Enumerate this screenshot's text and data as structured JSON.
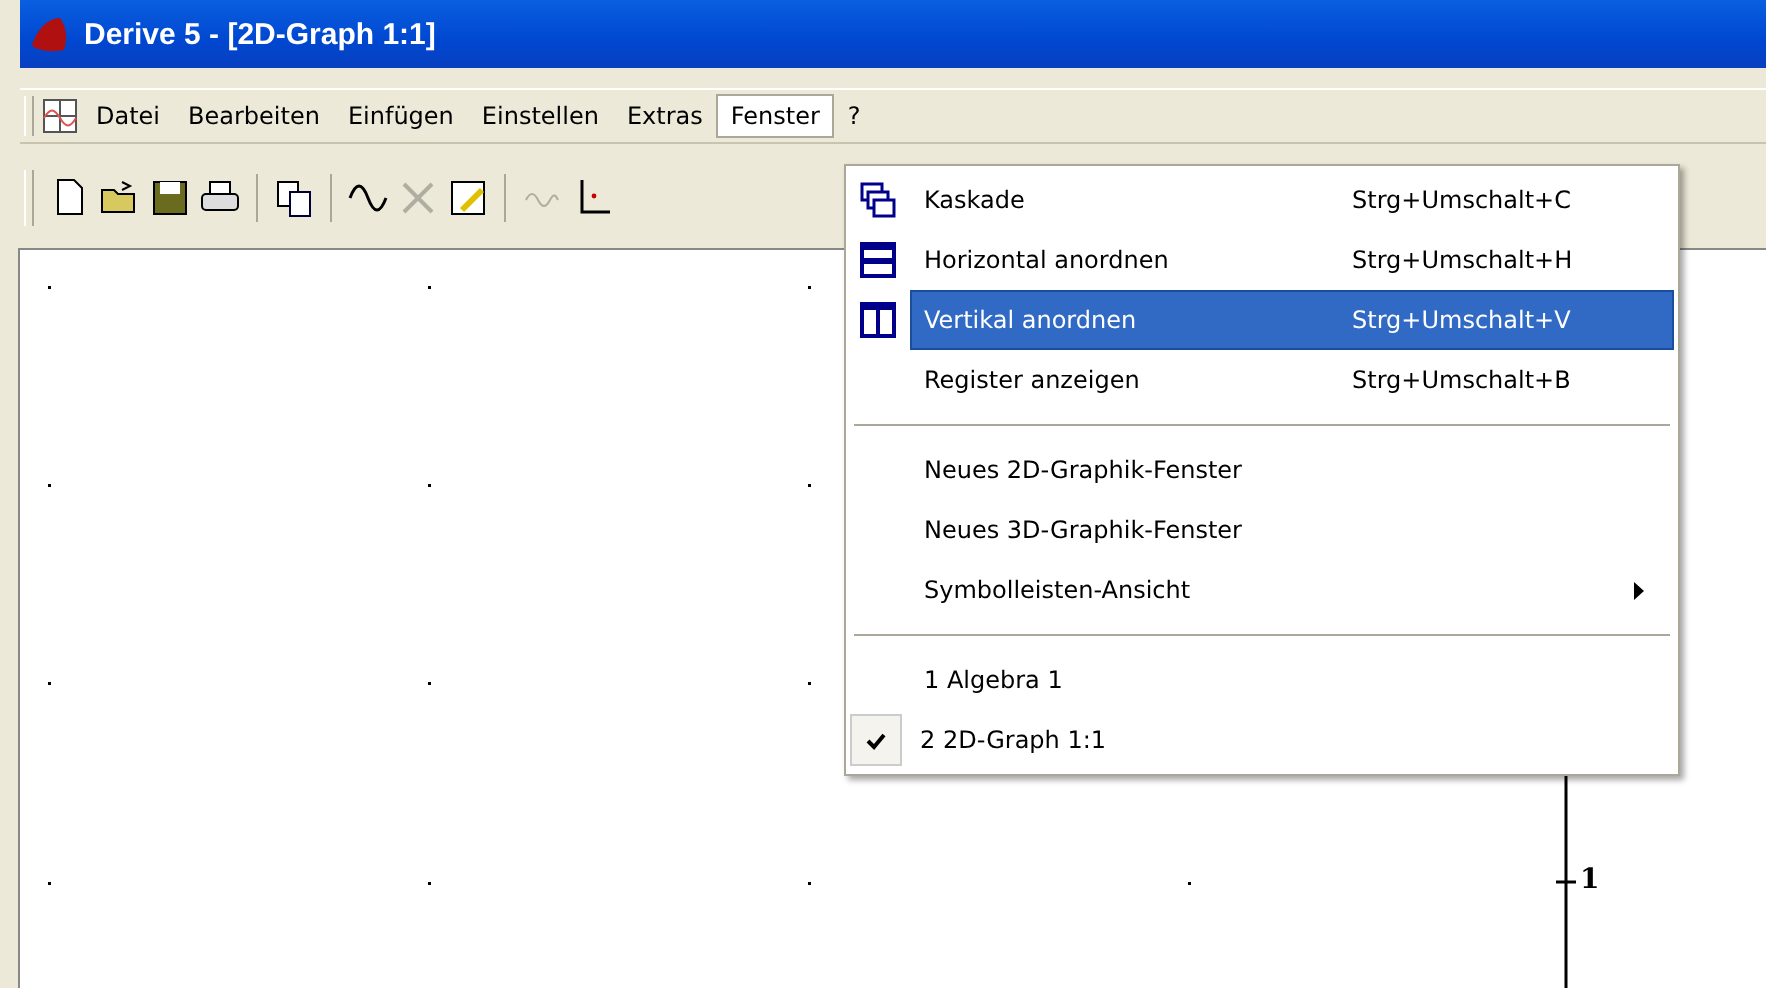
{
  "window": {
    "title": "Derive 5 - [2D-Graph 1:1]"
  },
  "menu_bar": [
    {
      "label": "Datei",
      "open": false
    },
    {
      "label": "Bearbeiten",
      "open": false
    },
    {
      "label": "Einfügen",
      "open": false
    },
    {
      "label": "Einstellen",
      "open": false
    },
    {
      "label": "Extras",
      "open": false
    },
    {
      "label": "Fenster",
      "open": true
    },
    {
      "label": "?",
      "open": false
    }
  ],
  "toolbar": [
    {
      "kind": "new",
      "disabled": false
    },
    {
      "kind": "open",
      "disabled": false
    },
    {
      "kind": "save",
      "disabled": false
    },
    {
      "kind": "print",
      "disabled": false
    },
    {
      "kind": "sep"
    },
    {
      "kind": "copy",
      "disabled": false
    },
    {
      "kind": "sep"
    },
    {
      "kind": "plot",
      "disabled": false
    },
    {
      "kind": "delete",
      "disabled": true
    },
    {
      "kind": "annotate",
      "disabled": false
    },
    {
      "kind": "sep"
    },
    {
      "kind": "trace",
      "disabled": true
    },
    {
      "kind": "axes",
      "disabled": false
    }
  ],
  "dropdown": [
    {
      "kind": "cascade",
      "label": "Kaskade",
      "shortcut": "Strg+Umschalt+C",
      "selected": false,
      "checked": false
    },
    {
      "kind": "tile_horizontal",
      "label": "Horizontal anordnen",
      "shortcut": "Strg+Umschalt+H",
      "selected": false,
      "checked": false
    },
    {
      "kind": "tile_vertical",
      "label": "Vertikal anordnen",
      "shortcut": "Strg+Umschalt+V",
      "selected": true,
      "checked": false
    },
    {
      "kind": "item",
      "label": "Register anzeigen",
      "shortcut": "Strg+Umschalt+B",
      "selected": false,
      "checked": false
    },
    {
      "kind": "separator"
    },
    {
      "kind": "item",
      "label": "Neues 2D-Graphik-Fenster",
      "selected": false,
      "checked": false
    },
    {
      "kind": "item",
      "label": "Neues 3D-Graphik-Fenster",
      "selected": false,
      "checked": false
    },
    {
      "kind": "submenu",
      "label": "Symbolleisten-Ansicht",
      "selected": false,
      "checked": false
    },
    {
      "kind": "separator"
    },
    {
      "kind": "item",
      "label": "1 Algebra 1",
      "selected": false,
      "checked": false
    },
    {
      "kind": "item",
      "label": "2 2D-Graph 1:1",
      "selected": false,
      "checked": true
    }
  ],
  "graph": {
    "y_tick_label": "1"
  }
}
